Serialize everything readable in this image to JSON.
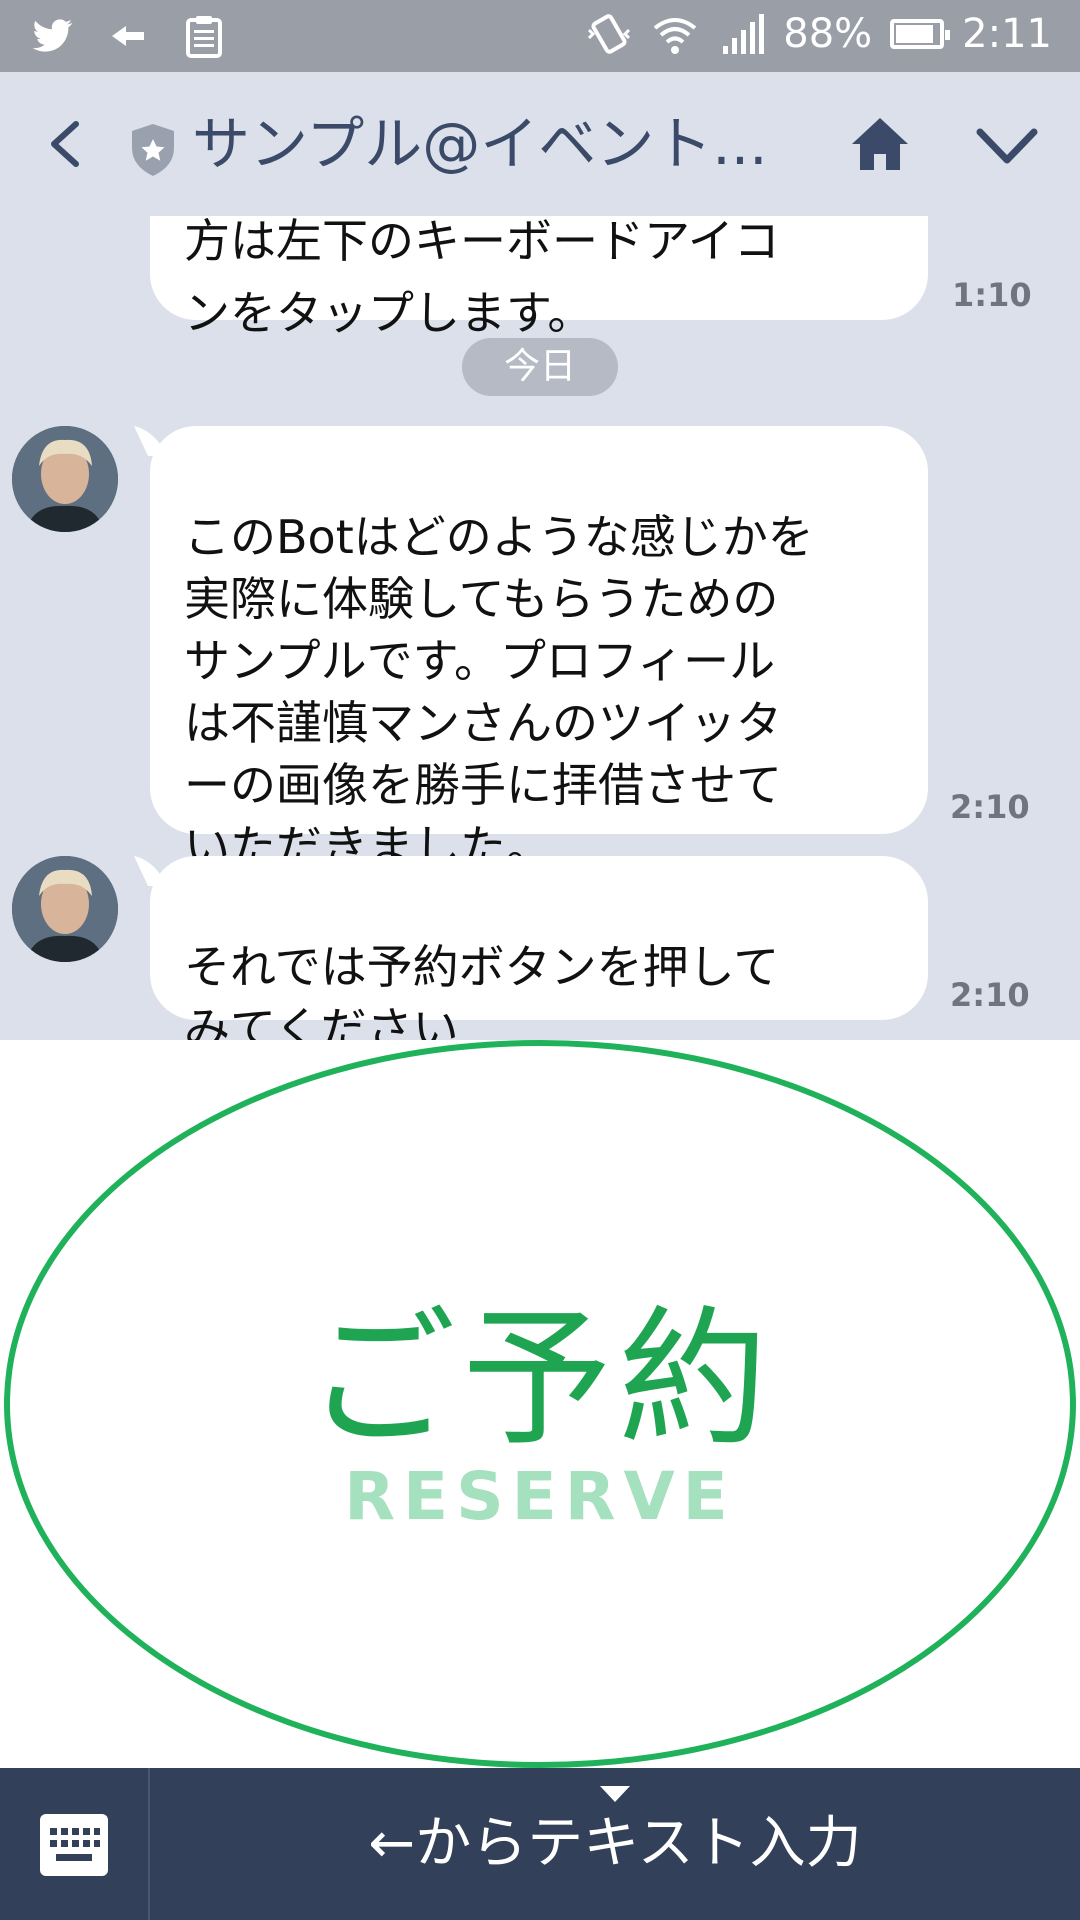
{
  "status_bar": {
    "left_icons": [
      "twitter-icon",
      "back-arrow-icon",
      "clipboard-icon"
    ],
    "battery_percent": "88%",
    "battery_level": 0.88,
    "time": "2:11"
  },
  "header": {
    "title": "サンプル@イベント...",
    "icons": [
      "back-icon",
      "shield-icon",
      "home-icon",
      "chevron-down-icon"
    ]
  },
  "chat": {
    "partial_message": {
      "cut_line": "方は左下のキーボードアイコ",
      "text": "ンをタップします。",
      "time": "1:10"
    },
    "date_separator": "今日",
    "messages": [
      {
        "text": "このBotはどのような感じかを\n実際に体験してもらうための\nサンプルです。プロフィール\nは不謹慎マンさんのツイッタ\nーの画像を勝手に拝借させて\nいただきました。",
        "time": "2:10"
      },
      {
        "text": "それでは予約ボタンを押して\nみてください",
        "time": "2:10"
      }
    ]
  },
  "rich_menu": {
    "label_jp": "ご予約",
    "label_en": "RESERVE",
    "accent_color": "#1fb25a"
  },
  "bottom_bar": {
    "input_hint": "←からテキスト入力",
    "background_color": "#334059"
  }
}
